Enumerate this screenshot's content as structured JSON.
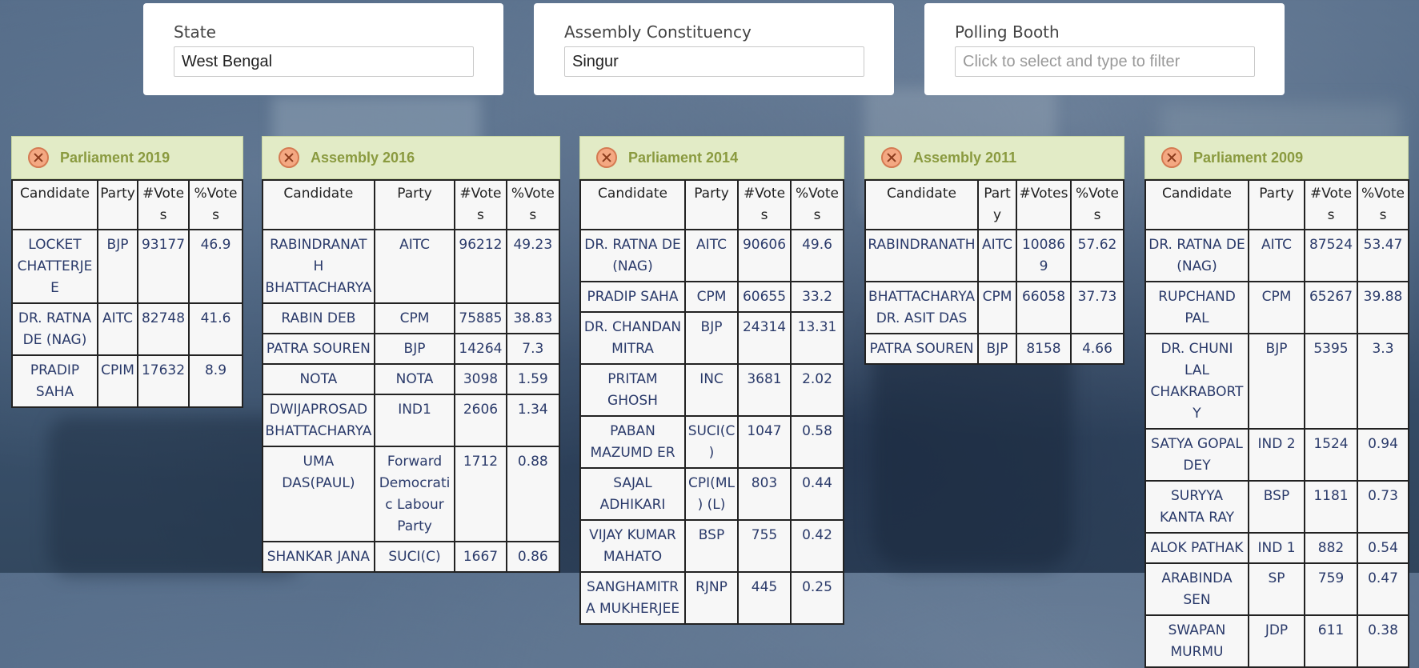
{
  "filters": [
    {
      "label": "State",
      "value": "West Bengal",
      "placeholder": ""
    },
    {
      "label": "Assembly Constituency",
      "value": "Singur",
      "placeholder": ""
    },
    {
      "label": "Polling Booth",
      "value": "",
      "placeholder": "Click to select and type to filter"
    }
  ],
  "columns": [
    "Candidate",
    "Party",
    "#Votes",
    "%Votes"
  ],
  "panels": [
    {
      "title": "Parliament 2019",
      "rows": [
        [
          "LOCKET CHATTERJEE",
          "BJP",
          "93177",
          "46.9"
        ],
        [
          "DR. RATNA DE (NAG)",
          "AITC",
          "82748",
          "41.6"
        ],
        [
          "PRADIP SAHA",
          "CPIM",
          "17632",
          "8.9"
        ]
      ]
    },
    {
      "title": "Assembly 2016",
      "rows": [
        [
          "RABINDRANATH BHATTACHARYA",
          "AITC",
          "96212",
          "49.23"
        ],
        [
          "RABIN DEB",
          "CPM",
          "75885",
          "38.83"
        ],
        [
          "PATRA SOUREN",
          "BJP",
          "14264",
          "7.3"
        ],
        [
          "NOTA",
          "NOTA",
          "3098",
          "1.59"
        ],
        [
          "DWIJAPROSAD BHATTACHARYA",
          "IND1",
          "2606",
          "1.34"
        ],
        [
          "UMA DAS(PAUL)",
          "Forward Democratic Labour Party",
          "1712",
          "0.88"
        ],
        [
          "SHANKAR JANA",
          "SUCI(C)",
          "1667",
          "0.86"
        ]
      ]
    },
    {
      "title": "Parliament 2014",
      "rows": [
        [
          "DR. RATNA DE (NAG)",
          "AITC",
          "90606",
          "49.6"
        ],
        [
          "PRADIP SAHA",
          "CPM",
          "60655",
          "33.2"
        ],
        [
          "DR. CHANDAN MITRA",
          "BJP",
          "24314",
          "13.31"
        ],
        [
          "PRITAM GHOSH",
          "INC",
          "3681",
          "2.02"
        ],
        [
          "PABAN MAZUMD ER",
          "SUCI(C)",
          "1047",
          "0.58"
        ],
        [
          "SAJAL ADHIKARI",
          "CPI(ML) (L)",
          "803",
          "0.44"
        ],
        [
          "VIJAY KUMAR MAHATO",
          "BSP",
          "755",
          "0.42"
        ],
        [
          "SANGHAMITRA MUKHERJEE",
          "RJNP",
          "445",
          "0.25"
        ]
      ]
    },
    {
      "title": "Assembly 2011",
      "rows": [
        [
          "RABINDRANATH",
          "AITC",
          "100869",
          "57.62"
        ],
        [
          "BHATTACHARYA DR. ASIT DAS",
          "CPM",
          "66058",
          "37.73"
        ],
        [
          "PATRA SOUREN",
          "BJP",
          "8158",
          "4.66"
        ]
      ]
    },
    {
      "title": "Parliament 2009",
      "rows": [
        [
          "DR. RATNA DE (NAG)",
          "AITC",
          "87524",
          "53.47"
        ],
        [
          "RUPCHAND PAL",
          "CPM",
          "65267",
          "39.88"
        ],
        [
          "DR. CHUNI LAL CHAKRABORTY",
          "BJP",
          "5395",
          "3.3"
        ],
        [
          "SATYA GOPAL DEY",
          "IND 2",
          "1524",
          "0.94"
        ],
        [
          "SURYYA KANTA RAY",
          "BSP",
          "1181",
          "0.73"
        ],
        [
          "ALOK PATHAK",
          "IND 1",
          "882",
          "0.54"
        ],
        [
          "ARABINDA SEN",
          "SP",
          "759",
          "0.47"
        ],
        [
          "SWAPAN MURMU",
          "JDP",
          "611",
          "0.38"
        ]
      ]
    }
  ]
}
